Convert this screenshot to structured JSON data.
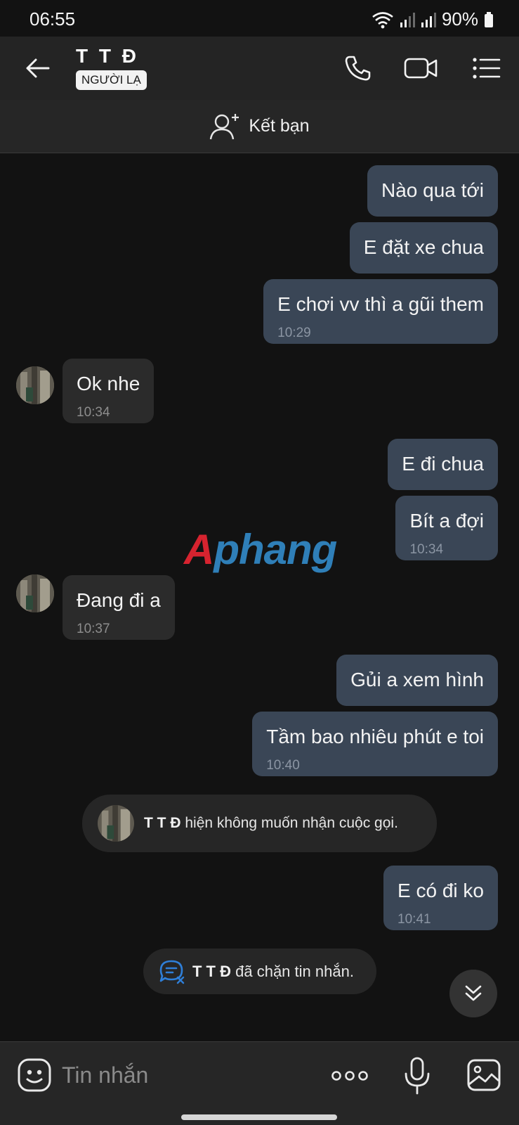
{
  "status_bar": {
    "time": "06:55",
    "battery": "90%"
  },
  "header": {
    "contact_name": "T T Đ",
    "badge": "NGƯỜI LẠ"
  },
  "add_friend": {
    "label": "Kết bạn"
  },
  "watermark": {
    "part1": "A",
    "part2": "phang"
  },
  "messages": [
    {
      "side": "me",
      "text": "Nào qua tới"
    },
    {
      "side": "me",
      "text": "E đặt xe chua"
    },
    {
      "side": "me",
      "text": "E chơi vv thì a gũi them",
      "time": "10:29"
    },
    {
      "side": "them",
      "text": "Ok nhe",
      "time": "10:34"
    },
    {
      "side": "me",
      "text": "E đi chua"
    },
    {
      "side": "me",
      "text": "Bít a đợi",
      "time": "10:34"
    },
    {
      "side": "them",
      "text": "Đang đi a",
      "time": "10:37"
    },
    {
      "side": "me",
      "text": "Gủi a xem hình"
    },
    {
      "side": "me",
      "text": "Tầm bao nhiêu phút e toi",
      "time": "10:40"
    },
    {
      "side": "me",
      "text": "E có đi ko",
      "time": "10:41"
    }
  ],
  "notices": {
    "call_blocked": {
      "name": "T T Đ",
      "text": "hiện không muốn nhận cuộc gọi."
    },
    "message_blocked": {
      "name": "T T Đ",
      "text": "đã chặn tin nhắn."
    }
  },
  "input": {
    "placeholder": "Tin nhắn"
  },
  "colors": {
    "my_bubble": "#3a4656",
    "their_bubble": "#2b2b2b",
    "background": "#121212",
    "accent_blue": "#2f7fd8"
  }
}
